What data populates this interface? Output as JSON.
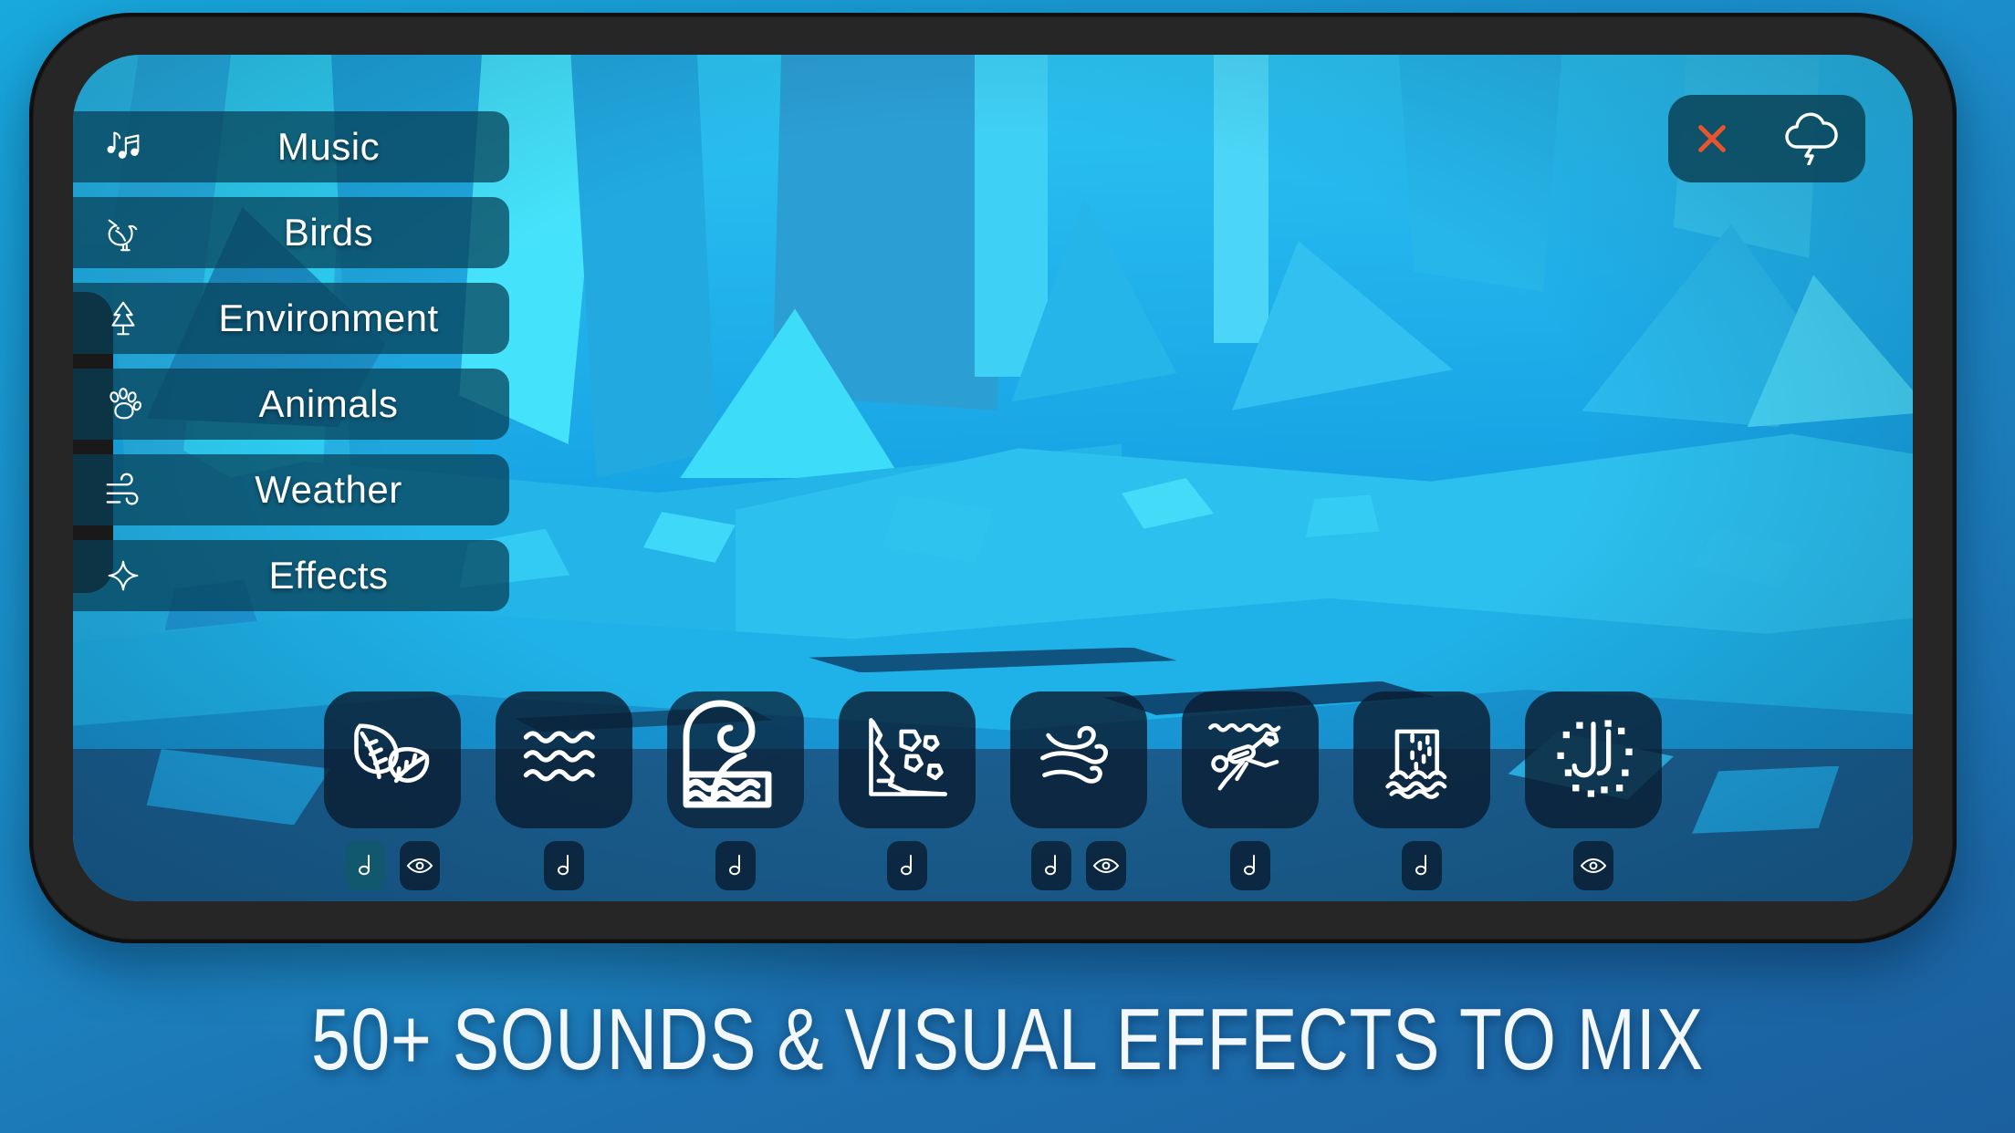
{
  "app": {
    "caption": "50+ SOUNDS & VISUAL EFFECTS TO MIX"
  },
  "sidebar": {
    "items": [
      {
        "label": "Music",
        "icon": "music-notes-icon"
      },
      {
        "label": "Birds",
        "icon": "bird-icon"
      },
      {
        "label": "Environment",
        "icon": "tree-icon"
      },
      {
        "label": "Animals",
        "icon": "paw-print-icon"
      },
      {
        "label": "Weather",
        "icon": "wind-icon"
      },
      {
        "label": "Effects",
        "icon": "sparkle-icon"
      }
    ]
  },
  "top_panel": {
    "close_label": "×",
    "close_color": "#e8552c",
    "weather_icon": "cloud-lightning-icon"
  },
  "dock": {
    "items": [
      {
        "name": "leaves",
        "icon": "leaves-icon",
        "sound": true,
        "visual": true,
        "active": true
      },
      {
        "name": "ripples",
        "icon": "water-ripples-icon",
        "sound": true,
        "visual": false,
        "active": false
      },
      {
        "name": "waves",
        "icon": "ocean-wave-icon",
        "sound": true,
        "visual": false,
        "active": false,
        "enlarged": true
      },
      {
        "name": "rockfall",
        "icon": "landslide-icon",
        "sound": true,
        "visual": false,
        "active": false
      },
      {
        "name": "wind",
        "icon": "wind-swirl-icon",
        "sound": true,
        "visual": true,
        "active": false
      },
      {
        "name": "diver",
        "icon": "scuba-diver-icon",
        "sound": true,
        "visual": false,
        "active": false
      },
      {
        "name": "waterfall",
        "icon": "waterfall-icon",
        "sound": true,
        "visual": false,
        "active": false
      },
      {
        "name": "rainfall",
        "icon": "rain-drops-icon",
        "sound": false,
        "visual": true,
        "active": false
      }
    ]
  },
  "colors": {
    "accent": "#e8552c",
    "panel": "rgba(9,62,82,.82)",
    "tile": "rgba(10,28,48,.80)",
    "scene_cyan": "#2ec6f2",
    "scene_blue": "#1380c9",
    "page_background": "#1b8fcb"
  }
}
